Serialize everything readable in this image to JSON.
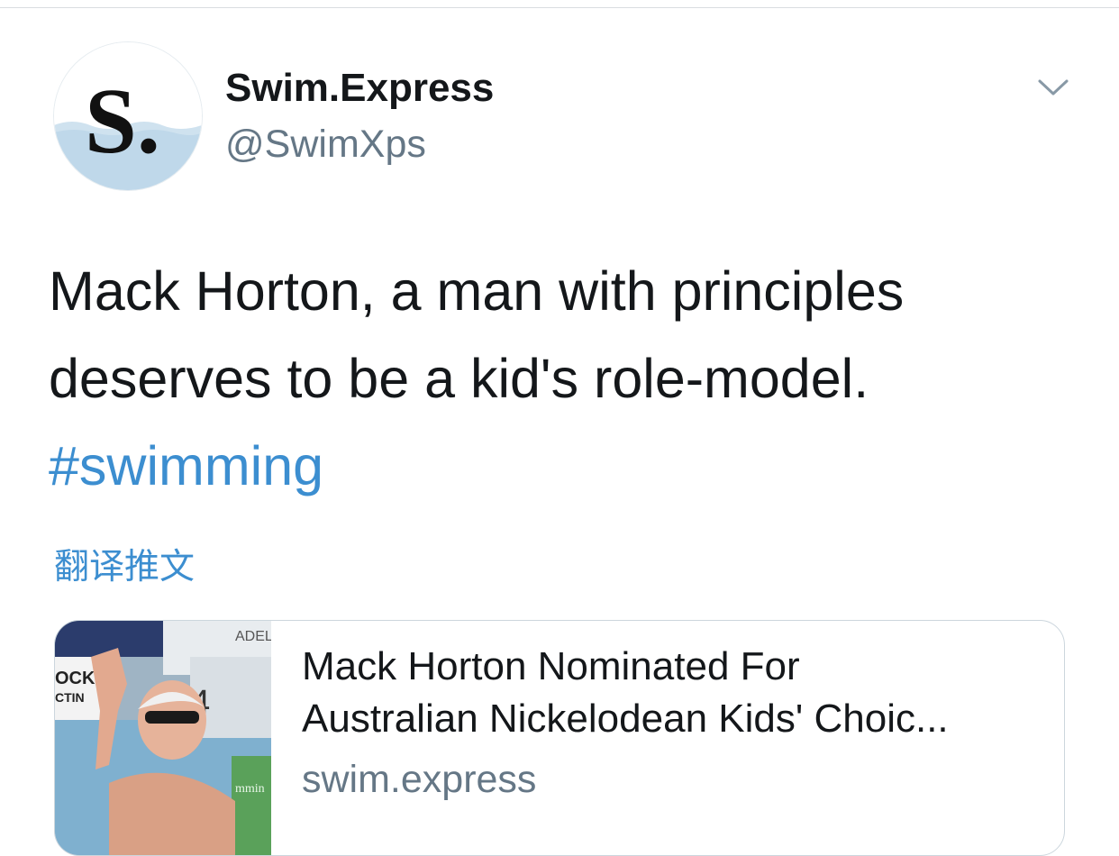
{
  "tweet": {
    "author": {
      "display_name": "Swim.Express",
      "handle": "@SwimXps",
      "avatar_icon": "swim-express-logo",
      "avatar_letter": "S."
    },
    "text_lines": [
      "Mack Horton, a man with principles",
      "deserves to be a kid's role-model."
    ],
    "hashtag": "#swimming",
    "translate_label": "翻译推文",
    "menu_icon": "chevron-down-icon",
    "link_card": {
      "title_lines": [
        "Mack Horton Nominated For",
        "Australian Nickelodean Kids' Choic..."
      ],
      "domain": "swim.express",
      "thumbnail_text": {
        "sign_top": "ADEL",
        "sign_left_1": "OCK",
        "sign_left_2": "CTIN",
        "lane_number": "4",
        "banner": "mmin"
      }
    }
  },
  "colors": {
    "text_primary": "#14171a",
    "text_secondary": "#657786",
    "link": "#3c8ed0",
    "border": "#ccd6dd"
  }
}
